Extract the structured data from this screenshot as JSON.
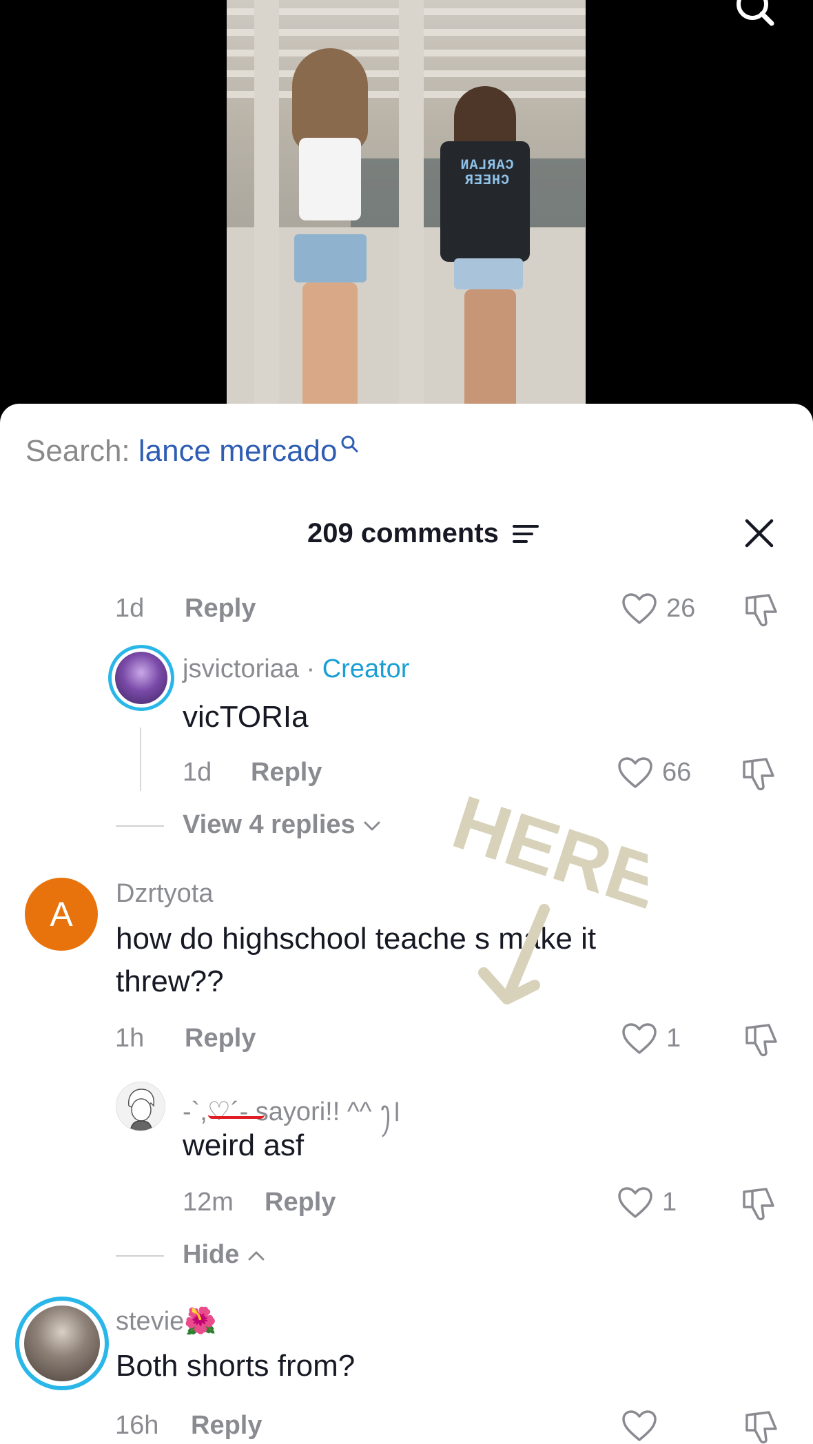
{
  "video": {
    "tee_text_line1": "CARLAN",
    "tee_text_line2": "CHEER"
  },
  "top_search_icon": "search-icon",
  "sheet": {
    "search_prefix": "Search:",
    "search_query": "lance mercado",
    "comment_count": "209 comments",
    "filter_icon": "filter-icon",
    "close_icon": "close-icon"
  },
  "comments": [
    {
      "meta": {
        "time": "1d",
        "reply": "Reply",
        "likes": "26"
      }
    },
    {
      "username": "jsvictoriaa",
      "creator_sep": " · ",
      "creator_label": "Creator",
      "text": "vicTORIa",
      "meta": {
        "time": "1d",
        "reply": "Reply",
        "likes": "66"
      }
    },
    {
      "view_replies": "View 4 replies"
    },
    {
      "avatar_letter": "A",
      "username": "Dzrtyota",
      "text": "how do highschool teache s make it threw??",
      "meta": {
        "time": "1h",
        "reply": "Reply",
        "likes": "1"
      }
    },
    {
      "username": "-`,♡´- sayori!! ^^ ꫂ꫰",
      "text": "weird asf",
      "meta": {
        "time": "12m",
        "reply": "Reply",
        "likes": "1"
      }
    },
    {
      "hide_label": "Hide"
    },
    {
      "username": "stevie🌺",
      "text": "Both shorts from?",
      "meta": {
        "time": "16h",
        "reply": "Reply"
      }
    }
  ],
  "overlay": {
    "here_text": "HERE",
    "color": "#d8d2ba"
  },
  "colors": {
    "query_link": "#2e5db3",
    "creator": "#1a9fd4",
    "avatar_orange": "#e8720c",
    "ring": "#29b6e8"
  }
}
